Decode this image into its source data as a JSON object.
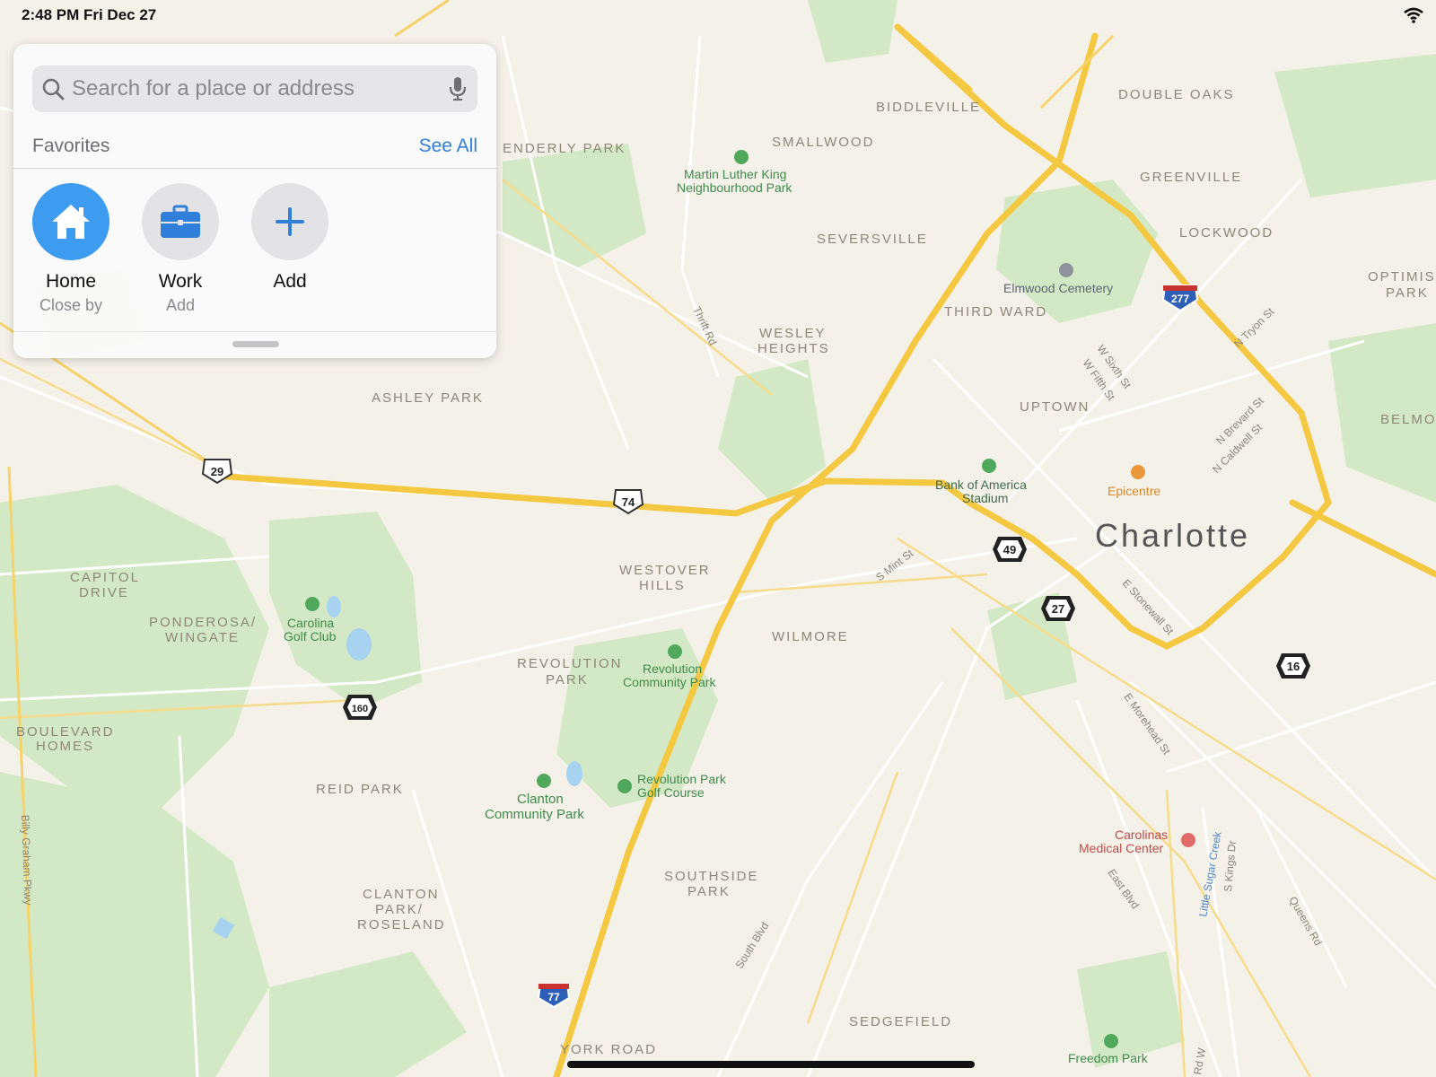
{
  "status_bar": {
    "time": "2:48 PM   Fri Dec 27"
  },
  "search": {
    "placeholder": "Search for a place or address"
  },
  "favorites": {
    "title": "Favorites",
    "see_all": "See All",
    "items": [
      {
        "label": "Home",
        "sub": "Close by",
        "icon": "house-icon",
        "color": "#3d9bf0"
      },
      {
        "label": "Work",
        "sub": "Add",
        "icon": "briefcase-icon",
        "color": "#e3e3e5"
      },
      {
        "label": "Add",
        "sub": "",
        "icon": "plus-icon",
        "color": "#e3e3e5"
      }
    ]
  },
  "map": {
    "city": "Charlotte",
    "neighborhoods": [
      "BIDDLEVILLE",
      "DOUBLE OAKS",
      "SMALLWOOD",
      "ENDERLY PARK",
      "GREENVILLE",
      "LOCKWOOD",
      "SEVERSVILLE",
      "OPTIMIST PARK",
      "THIRD WARD",
      "WESLEY HEIGHTS",
      "UPTOWN",
      "BELMO",
      "ASHLEY PARK",
      "WESTOVER HILLS",
      "CAPITOL DRIVE",
      "PONDEROSA/ WINGATE",
      "WILMORE",
      "REVOLUTION PARK",
      "BOULEVARD HOMES",
      "REID PARK",
      "SOUTHSIDE PARK",
      "CLANTON PARK/ ROSELAND",
      "SEDGEFIELD",
      "YORK ROAD"
    ],
    "parks": [
      "Martin Luther King Neighbourhood Park",
      "Carolina Golf Club",
      "Revolution Community Park",
      "Revolution Park Golf Course",
      "Clanton Community Park",
      "Freedom Park"
    ],
    "pois": [
      "Elmwood Cemetery",
      "Bank of America Stadium",
      "Epicentre",
      "Carolinas Medical Center"
    ],
    "roads": [
      "Thrift Rd",
      "W Sixth St",
      "W Fifth St",
      "N Tryon St",
      "N Brevard St",
      "N Caldwell St",
      "S Mint St",
      "E Stonewall St",
      "E Morehead St",
      "East Blvd",
      "South Blvd",
      "Queens Rd",
      "S Kings Dr",
      "Billy Graham Pkwy",
      "Rd W"
    ],
    "creek": "Little Sugar Creek",
    "shields": [
      "29",
      "74",
      "49",
      "27",
      "16",
      "160",
      "277",
      "77"
    ],
    "colors": {
      "land": "#f4f1e8",
      "green": "#cfe7c0",
      "highway": "#f5c842",
      "street": "#ffffff",
      "water": "#a8d3f0"
    }
  }
}
